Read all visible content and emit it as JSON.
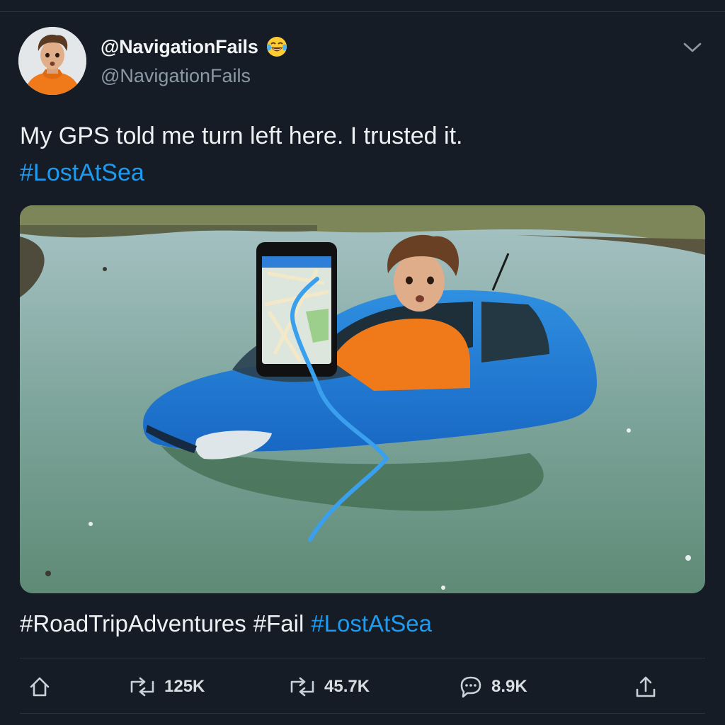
{
  "author": {
    "display_name": "@NavigationFails",
    "emoji": "laughing-tears-emoji",
    "handle": "@NavigationFails"
  },
  "tweet": {
    "line1": "My GPS told me turn left here. I trusted it.",
    "line2_hashtag": "#LostAtSea"
  },
  "media": {
    "description_icon": "photo"
  },
  "footer_tags": {
    "tag1": "#RoadTripAdventures",
    "tag2": "#Fail",
    "tag3": "#LostAtSea"
  },
  "actions": {
    "retweet_count": "125K",
    "quote_count": "45.7K",
    "reply_count": "8.9K"
  },
  "colors": {
    "background": "#151c26",
    "accent": "#1d9bf0",
    "secondary_text": "#8b98a5",
    "divider": "#2a333f"
  },
  "icons": [
    "chevron-down-icon",
    "home-icon",
    "retweet-icon",
    "quote-retweet-icon",
    "reply-icon",
    "share-icon"
  ]
}
